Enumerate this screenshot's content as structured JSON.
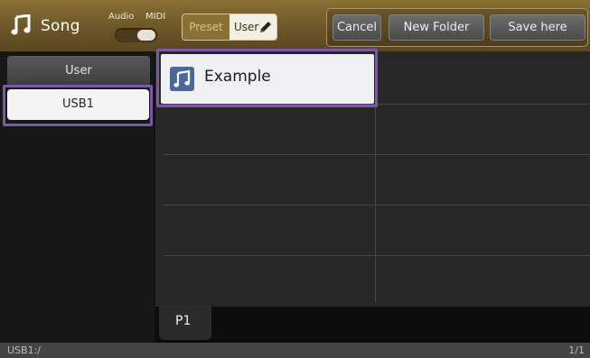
{
  "header": {
    "title": "Song",
    "audio_label": "Audio",
    "midi_label": "MIDI",
    "tabs": {
      "preset": "Preset",
      "user": "User"
    },
    "actions": {
      "cancel": "Cancel",
      "new_folder": "New Folder",
      "save_here": "Save here"
    }
  },
  "sidebar": {
    "items": [
      {
        "label": "User"
      },
      {
        "label": "USB1"
      }
    ]
  },
  "files": [
    {
      "name": "Example"
    }
  ],
  "pager": {
    "current": "P1"
  },
  "status": {
    "path": "USB1:/",
    "page": "1/1"
  },
  "colors": {
    "accent_purple": "#7b57a8",
    "header_gold": "#7a6230"
  }
}
